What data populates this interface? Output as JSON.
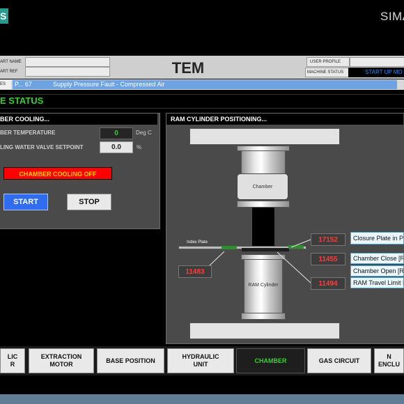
{
  "brand": {
    "badge": "S",
    "name": "SIMA"
  },
  "header": {
    "part_name_label": "ART NAME",
    "part_ref_label": "ART REF",
    "title": "TEM",
    "user_profile_label": "USER PROFILE",
    "machine_status_label": "MACHINE STATUS",
    "machine_status_value": "START UP MO"
  },
  "alarm": {
    "tag": "ES",
    "code": "P... 67",
    "message": "Supply Pressure Fault - Compressed Air"
  },
  "status_title": "E STATUS",
  "cooling": {
    "title": "BER COOLING...",
    "temp_label": "BER TEMPERATURE",
    "temp_value": "0",
    "temp_unit": "Deg C",
    "valve_label": "LING WATER VALVE SETPOINT",
    "valve_value": "0.0",
    "valve_unit": "%",
    "alarm_text": "CHAMBER COOLING OFF",
    "start_label": "START",
    "stop_label": "STOP"
  },
  "ram": {
    "title": "RAM CYLINDER POSITIONING...",
    "chamber_label": "Chamber",
    "index_plate_label": "Index Plate",
    "ram_cylinder_label": "RAM Cylinder",
    "counter_left": "11483",
    "counter_right_top": "17152",
    "counter_right_mid": "11455",
    "counter_right_bottom": "11494",
    "sig_closure": "Closure Plate in Po",
    "sig_close": "Chamber Close [RA",
    "sig_open": "Chamber Open [RA",
    "sig_travel": "RAM Travel Limit E"
  },
  "nav": [
    {
      "label": "LIC\nR",
      "active": false
    },
    {
      "label": "EXTRACTION\nMOTOR",
      "active": false
    },
    {
      "label": "BASE POSITION",
      "active": false
    },
    {
      "label": "HYDRAULIC\nUNIT",
      "active": false
    },
    {
      "label": "CHAMBER",
      "active": true
    },
    {
      "label": "GAS CIRCUIT",
      "active": false
    },
    {
      "label": "N\nENCLU",
      "active": false
    }
  ],
  "colors": {
    "accent_green": "#35d12f",
    "alarm_red": "#ff0000",
    "start_blue": "#2f6cf0",
    "counter_red": "#ff3a3a"
  }
}
